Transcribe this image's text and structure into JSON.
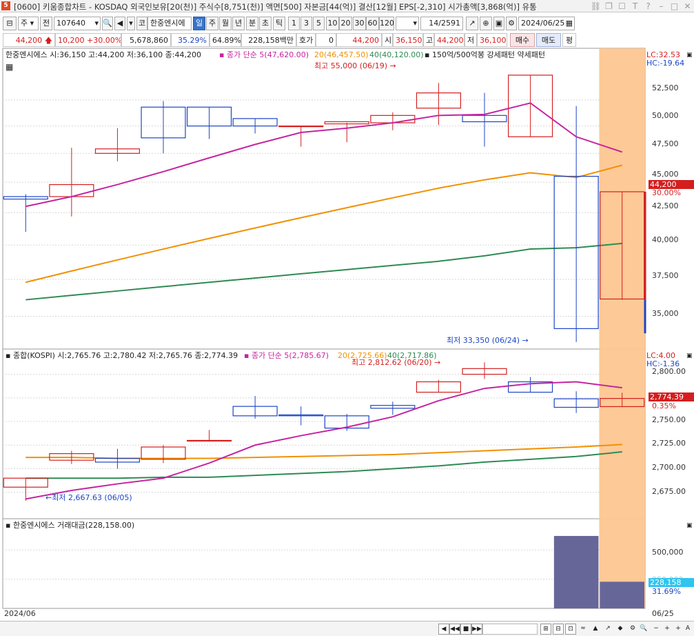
{
  "window": {
    "title": "[0600] 키움종합차트 - KOSDAQ 외국인보유[20(천)] 주식수[8,751(천)] 액면[500] 자본금[44(억)] 결산[12월] EPS[-2,310] 시가총액[3,868(억)] 유통",
    "app_badge": "5"
  },
  "toolbar": {
    "menu_label": "주",
    "prev_label": "전",
    "code_value": "107640",
    "market_btn": "코",
    "stock_name": "한중엔시에",
    "periods": [
      "일",
      "주",
      "월",
      "년",
      "분",
      "초",
      "틱"
    ],
    "active_period": "일",
    "minutes": [
      "1",
      "3",
      "5",
      "10",
      "20",
      "30",
      "60",
      "120"
    ],
    "count_value": "14",
    "count_total": "/2591",
    "date_value": "2024/06/25"
  },
  "quote": {
    "price": "44,200",
    "change": "10,200",
    "change_pct": "+30.00%",
    "volume": "5,678,860",
    "turnover_pct": "35.29%",
    "ratio_pct": "64.89%",
    "amount": "228,158백만",
    "hoga_label": "호가",
    "hoga_value": "0",
    "hoga_price": "44,200",
    "open_label": "시",
    "open": "36,150",
    "high_label": "고",
    "high": "44,200",
    "low_label": "저",
    "low": "36,100",
    "buy_label": "매수",
    "sell_label": "매도",
    "eval_label": "평"
  },
  "panes": {
    "price": {
      "title": "한중엔시에스 시:36,150 고:44,200 저:36,100 종:44,200",
      "ma_title": "종가 단순 5(47,620.00)",
      "ma20": "20(46,457.50)",
      "ma40": "40(40,120.00)",
      "pattern": "150억/500억봉 강세패턴  약세패턴",
      "lc": "LC:32.53",
      "hc": "HC:-19.64",
      "high_note": "최고 55,000 (06/19)",
      "low_note": "최저 33,350 (06/24)",
      "price_tag": "44,200",
      "pct_tag": "30.00%",
      "yticks": [
        "52,500",
        "50,000",
        "47,500",
        "45,000",
        "42,500",
        "40,000",
        "37,500",
        "35,000"
      ]
    },
    "kospi": {
      "title": "종합(KOSPI) 시:2,765.76 고:2,780.42 저:2,765.76 종:2,774.39",
      "ma_title": "종가 단순 5(2,785.67)",
      "ma20": "20(2,725.66)",
      "ma40": "40(2,717.86)",
      "lc": "LC:4.00",
      "hc": "HC:-1.36",
      "high_note": "최고 2,812.62 (06/20)",
      "low_note": "최저 2,667.63 (06/05)",
      "price_tag": "2,774.39",
      "pct_tag": "0.35%",
      "yticks": [
        "2,800.00",
        "2,775.00",
        "2,750.00",
        "2,725.00",
        "2,700.00",
        "2,675.00"
      ]
    },
    "amount": {
      "title": "한중엔시에스 거래대금(228,158.00)",
      "ytick": "500,000",
      "ytick_hidden": "250,000",
      "value_tag": "228,158",
      "pct_tag": "31.69%"
    }
  },
  "xaxis": {
    "left": "2024/06",
    "right": "06/25"
  },
  "colors": {
    "up": "#d41e1e",
    "down": "#1c45c6",
    "ma5": "#c5259f",
    "ma20": "#f19000",
    "ma40": "#2e8a53",
    "highlight": "#fdc690",
    "volume": "#676699"
  },
  "chart_data": [
    {
      "type": "candlestick",
      "title": "한중엔시에스",
      "unit": "KRW",
      "ylim": [
        33300,
        56000
      ],
      "candles": [
        {
          "o": 43800,
          "h": 44000,
          "l": 41000,
          "c": 43600
        },
        {
          "o": 43800,
          "h": 48000,
          "l": 42200,
          "c": 44800
        },
        {
          "o": 47500,
          "h": 49800,
          "l": 46800,
          "c": 47900
        },
        {
          "o": 51800,
          "h": 52400,
          "l": 47500,
          "c": 48900
        },
        {
          "o": 51800,
          "h": 51800,
          "l": 48800,
          "c": 50000
        },
        {
          "o": 50700,
          "h": 50700,
          "l": 49300,
          "c": 50000
        },
        {
          "o": 50000,
          "h": 50000,
          "l": 48100,
          "c": 50000
        },
        {
          "o": 50200,
          "h": 50300,
          "l": 48500,
          "c": 50400
        },
        {
          "o": 50300,
          "h": 51300,
          "l": 49600,
          "c": 51000
        },
        {
          "o": 51700,
          "h": 54200,
          "l": 50100,
          "c": 53200
        },
        {
          "o": 51000,
          "h": 53200,
          "l": 48100,
          "c": 50400
        },
        {
          "o": 49000,
          "h": 55000,
          "l": 49000,
          "c": 55000
        },
        {
          "o": 45500,
          "h": 51900,
          "l": 33350,
          "c": 34200
        },
        {
          "o": 36150,
          "h": 44200,
          "l": 36100,
          "c": 44200
        }
      ],
      "ma5": [
        43000,
        43800,
        44800,
        45900,
        47100,
        48300,
        49400,
        49800,
        50300,
        51000,
        51100,
        52200,
        49000,
        47620
      ],
      "ma20": [
        37300,
        38100,
        38900,
        39700,
        40500,
        41300,
        42100,
        42900,
        43700,
        44500,
        45200,
        45800,
        45400,
        46457.5
      ],
      "ma40": [
        36100,
        36400,
        36700,
        37000,
        37300,
        37600,
        37900,
        38200,
        38500,
        38800,
        39200,
        39700,
        39800,
        40120
      ]
    },
    {
      "type": "candlestick",
      "title": "종합(KOSPI)",
      "ylim": [
        2650,
        2815
      ],
      "candles": [
        {
          "o": 2680.5,
          "h": 2690,
          "l": 2666,
          "c": 2690
        },
        {
          "o": 2709,
          "h": 2719,
          "l": 2705,
          "c": 2716
        },
        {
          "o": 2711,
          "h": 2721,
          "l": 2700,
          "c": 2707
        },
        {
          "o": 2710,
          "h": 2725,
          "l": 2706,
          "c": 2723
        },
        {
          "o": 2730,
          "h": 2741,
          "l": 2729,
          "c": 2730
        },
        {
          "o": 2766,
          "h": 2777,
          "l": 2753,
          "c": 2756
        },
        {
          "o": 2757,
          "h": 2766,
          "l": 2746,
          "c": 2756
        },
        {
          "o": 2756,
          "h": 2758,
          "l": 2740,
          "c": 2743
        },
        {
          "o": 2767,
          "h": 2771,
          "l": 2757,
          "c": 2764
        },
        {
          "o": 2781,
          "h": 2794,
          "l": 2781,
          "c": 2792
        },
        {
          "o": 2800,
          "h": 2812.62,
          "l": 2795,
          "c": 2806
        },
        {
          "o": 2792,
          "h": 2797,
          "l": 2781,
          "c": 2781
        },
        {
          "o": 2774,
          "h": 2782,
          "l": 2759,
          "c": 2765
        },
        {
          "o": 2765.76,
          "h": 2780.42,
          "l": 2765.76,
          "c": 2774.39
        }
      ],
      "ma5": [
        2668,
        2677,
        2684,
        2690,
        2706,
        2725,
        2735,
        2744,
        2755,
        2772,
        2785,
        2790,
        2792,
        2785.67
      ],
      "ma20": [
        2712,
        2712,
        2711,
        2711,
        2711,
        2712,
        2713,
        2714,
        2715,
        2717,
        2719,
        2721,
        2723,
        2725.66
      ],
      "ma40": [
        2690,
        2690,
        2690,
        2691,
        2691,
        2693,
        2695,
        2697,
        2700,
        2703,
        2707,
        2710,
        2713,
        2717.86
      ]
    },
    {
      "type": "bar",
      "title": "거래대금",
      "values": [
        0,
        0,
        0,
        0,
        0,
        0,
        0,
        0,
        0,
        0,
        0,
        0,
        620000,
        228158
      ],
      "ylim": [
        0,
        720000
      ]
    }
  ]
}
